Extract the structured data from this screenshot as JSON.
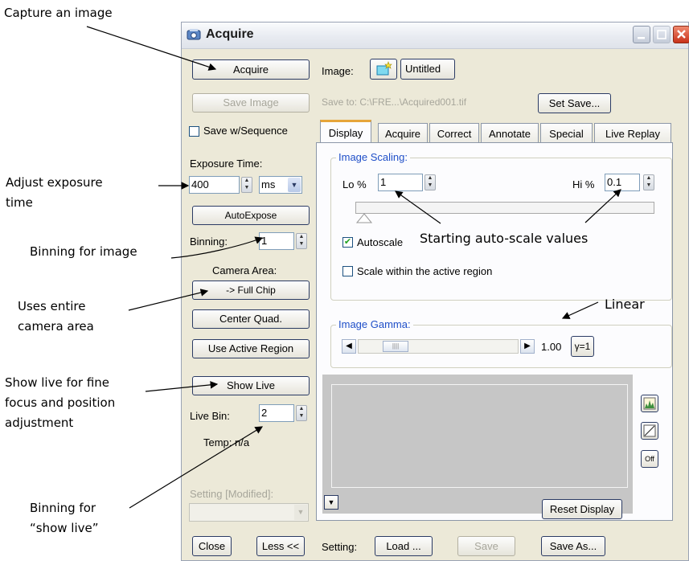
{
  "annotations": {
    "capture": "Capture an image",
    "exposure_1": "Adjust exposure",
    "exposure_2": "time",
    "binning": "Binning for image",
    "camera_1": "Uses entire",
    "camera_2": "camera area",
    "live_1": "Show live for fine",
    "live_2": "focus and position",
    "live_3": "adjustment",
    "binlive_1": "Binning for",
    "binlive_2": "“show live”",
    "autoscale": "Starting auto-scale values",
    "linear": "Linear"
  },
  "window": {
    "title": "Acquire"
  },
  "left": {
    "acquire_label": "Acquire",
    "save_image_label": "Save Image",
    "save_sequence_label": "Save w/Sequence",
    "save_sequence_checked": false,
    "exposure_label": "Exposure Time:",
    "exposure_value": "400",
    "exposure_unit": "ms",
    "autoexpose_label": "AutoExpose",
    "binning_label": "Binning:",
    "binning_value": "1",
    "camera_area_label": "Camera Area:",
    "full_chip_label": "-> Full Chip",
    "center_quad_label": "Center Quad.",
    "active_region_label": "Use Active Region",
    "show_live_label": "Show Live",
    "live_bin_label": "Live Bin:",
    "live_bin_value": "2",
    "temp_label": "Temp: n/a",
    "setting_modified_label": "Setting [Modified]:",
    "setting_value": ""
  },
  "right": {
    "image_label": "Image:",
    "image_name": "Untitled",
    "save_to": "Save to: C:\\FRE...\\Acquired001.tif",
    "set_save_label": "Set Save...",
    "tabs": [
      {
        "label": "Display"
      },
      {
        "label": "Acquire"
      },
      {
        "label": "Correct"
      },
      {
        "label": "Annotate"
      },
      {
        "label": "Special"
      },
      {
        "label": "Live Replay"
      }
    ],
    "image_scaling_title": "Image Scaling:",
    "lo_label": "Lo %",
    "lo_value": "1",
    "hi_label": "Hi %",
    "hi_value": "0.1",
    "autoscale_label": "Autoscale",
    "autoscale_checked": true,
    "scale_active_label": "Scale within the active region",
    "scale_active_checked": false,
    "gamma_title": "Image Gamma:",
    "gamma_value": "1.00",
    "gamma_reset_label": "γ=1",
    "gamma_slider_level": 0.12,
    "reset_display_label": "Reset Display",
    "side_off_label": "Off"
  },
  "bottom": {
    "close_label": "Close",
    "less_label": "Less <<",
    "setting_label": "Setting:",
    "load_label": "Load ...",
    "save_label": "Save",
    "save_as_label": "Save As..."
  },
  "colors": {
    "accent": "#1f4fc8",
    "tab_highlight": "#e6a53a",
    "preview": "#c6c6c6"
  }
}
